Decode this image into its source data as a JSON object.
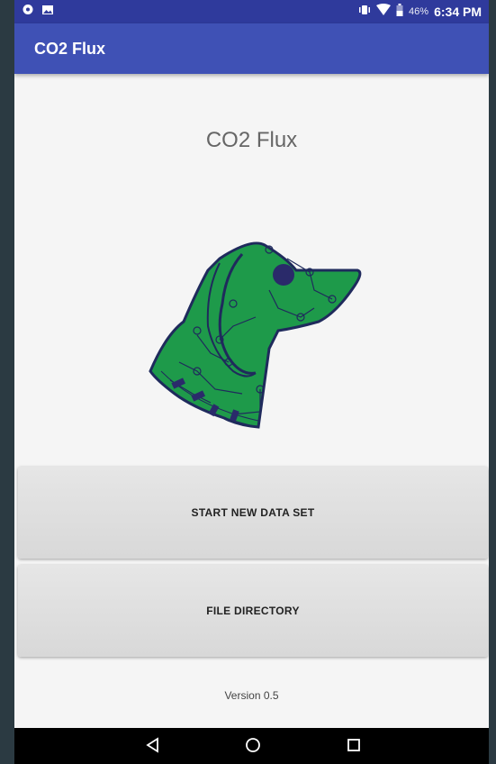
{
  "status_bar": {
    "battery": "46%",
    "time": "6:34 PM"
  },
  "app_bar": {
    "title": "CO2 Flux"
  },
  "main": {
    "heading": "CO2 Flux",
    "logo_icon": "dog-circuit-logo",
    "buttons": {
      "start": "START NEW DATA SET",
      "files": "FILE DIRECTORY"
    },
    "version": "Version 0.5"
  },
  "nav_bar": {
    "icons": [
      "back-icon",
      "home-icon",
      "recents-icon"
    ]
  },
  "colors": {
    "app_bar": "#3f51b5",
    "status_bar": "#2f3a9c",
    "logo_fill": "#1e9a4a",
    "logo_outline": "#1f2a5c"
  }
}
